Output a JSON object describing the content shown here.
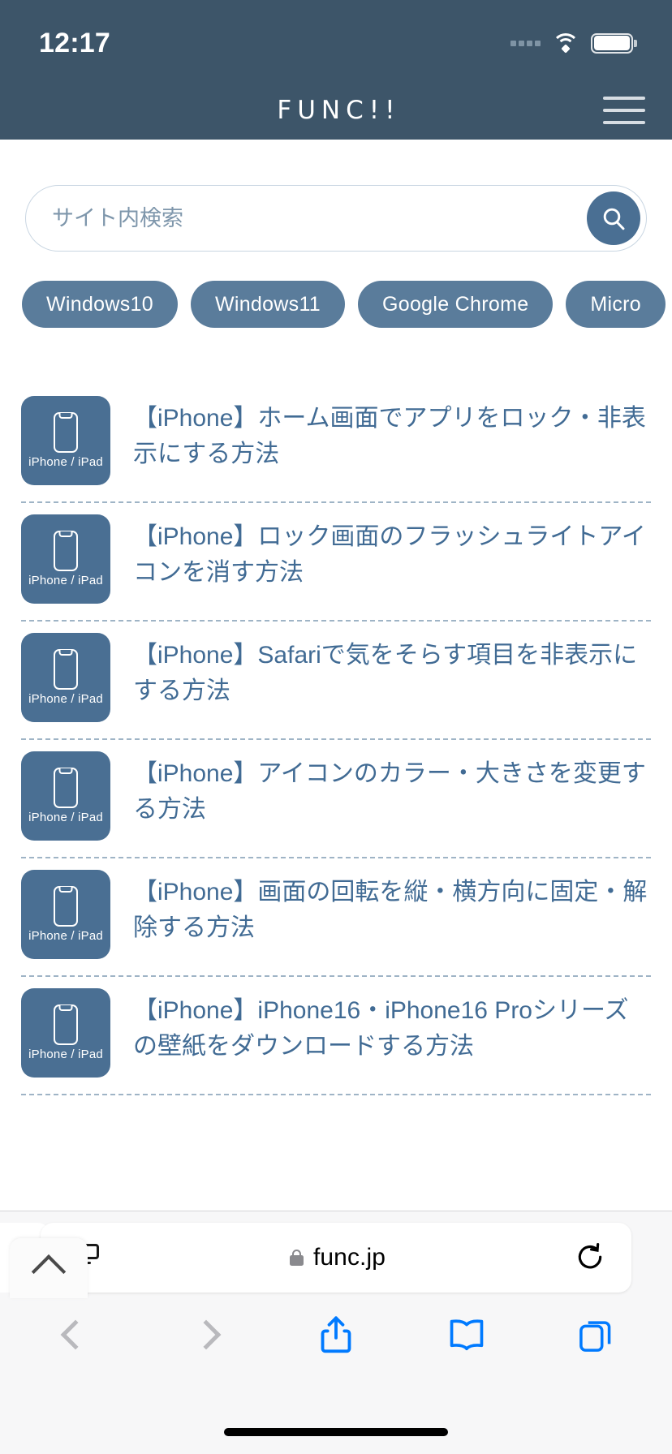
{
  "status_bar": {
    "time": "12:17",
    "wifi_icon": "wifi-icon",
    "battery_icon": "battery-icon",
    "signal_icon": "signal-dots-icon"
  },
  "site_header": {
    "logo": "FUNC!!",
    "menu_icon": "hamburger-menu-icon"
  },
  "search": {
    "placeholder": "サイト内検索",
    "value": "",
    "button_icon": "search-icon"
  },
  "tags": [
    {
      "label": "Windows10"
    },
    {
      "label": "Windows11"
    },
    {
      "label": "Google Chrome"
    },
    {
      "label": "Micro"
    }
  ],
  "articles": [
    {
      "category": "iPhone / iPad",
      "title": "【iPhone】ホーム画面でアプリをロック・非表示にする方法"
    },
    {
      "category": "iPhone / iPad",
      "title": "【iPhone】ロック画面のフラッシュライトアイコンを消す方法"
    },
    {
      "category": "iPhone / iPad",
      "title": "【iPhone】Safariで気をそらす項目を非表示にする方法"
    },
    {
      "category": "iPhone / iPad",
      "title": "【iPhone】アイコンのカラー・大きさを変更する方法"
    },
    {
      "category": "iPhone / iPad",
      "title": "【iPhone】画面の回転を縦・横方向に固定・解除する方法"
    },
    {
      "category": "iPhone / iPad",
      "title": "【iPhone】iPhone16・iPhone16 Proシリーズの壁紙をダウンロードする方法"
    }
  ],
  "scroll_top": {
    "icon": "chevron-up-icon"
  },
  "browser": {
    "url": "func.jp",
    "lock_icon": "lock-icon",
    "page_settings_icon": "page-settings-aa-icon",
    "reload_icon": "reload-icon",
    "back_icon": "chevron-left-icon",
    "forward_icon": "chevron-right-icon",
    "share_icon": "share-icon",
    "bookmarks_icon": "bookmarks-book-icon",
    "tabs_icon": "tabs-icon"
  },
  "colors": {
    "header_bg": "#3d5569",
    "accent": "#4a6f93",
    "chip_bg": "#5a7c9b",
    "title_link": "#416b94",
    "toolbar_blue": "#007aff"
  }
}
